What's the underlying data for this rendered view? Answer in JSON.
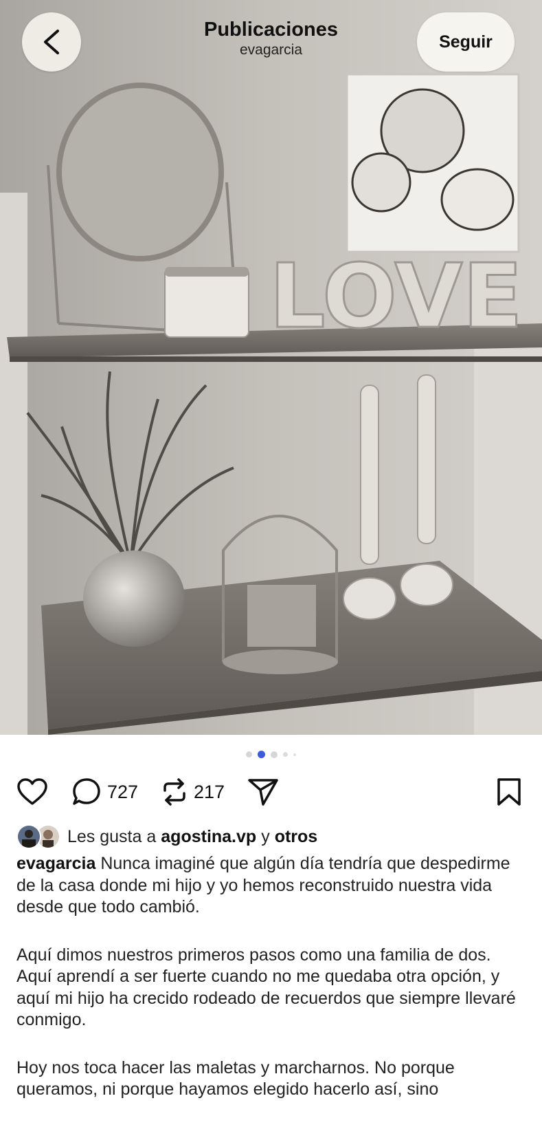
{
  "header": {
    "title": "Publicaciones",
    "username": "evagarcia",
    "follow_label": "Seguir"
  },
  "carousel": {
    "total": 5,
    "active_index": 1
  },
  "photo": {
    "love_text": "LOVE"
  },
  "actions": {
    "comments_count": "727",
    "reposts_count": "217"
  },
  "likes": {
    "prefix": "Les gusta a",
    "user": "agostina.vp",
    "conjunction": "y",
    "others": "otros"
  },
  "caption": {
    "author": "evagarcia",
    "p1": "Nunca imaginé que algún día tendría que despedirme de la casa donde mi hijo y yo hemos reconstruido nuestra vida desde que todo cambió.",
    "p2": "Aquí dimos nuestros primeros pasos como una familia de dos. Aquí aprendí a ser fuerte cuando no me quedaba otra opción, y aquí mi hijo ha crecido rodeado de recuerdos que siempre llevaré conmigo.",
    "p3": "Hoy nos toca hacer las maletas y marcharnos. No porque queramos, ni porque hayamos elegido hacerlo así, sino"
  },
  "colors": {
    "active_dot": "#3b5bdb",
    "inactive_dot": "#d6d6d6"
  },
  "icons": [
    "back-icon",
    "heart-icon",
    "comment-icon",
    "repost-icon",
    "share-icon",
    "bookmark-icon"
  ]
}
